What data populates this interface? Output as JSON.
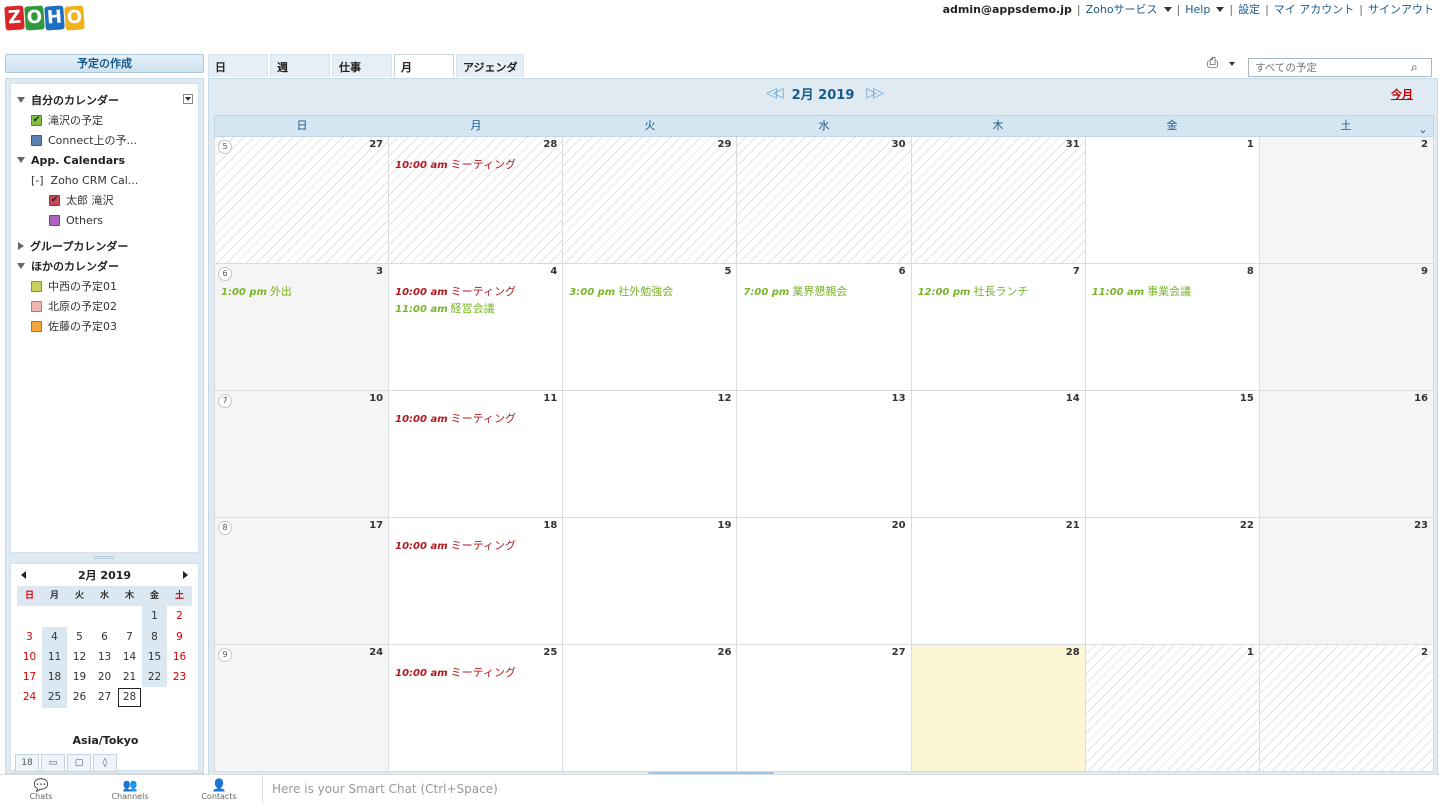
{
  "header": {
    "logo_letters": [
      "Z",
      "O",
      "H",
      "O"
    ],
    "logo_colors": [
      "#d8262a",
      "#2f9b3c",
      "#1d6fbf",
      "#f2b21c"
    ],
    "email": "admin@appsdemo.jp",
    "links": [
      {
        "label": "Zohoサービス",
        "dropdown": true
      },
      {
        "label": "Help",
        "dropdown": true
      },
      {
        "label": "設定",
        "dropdown": false
      },
      {
        "label": "マイ アカウント",
        "dropdown": false
      },
      {
        "label": "サインアウト",
        "dropdown": false
      }
    ]
  },
  "sidebar": {
    "create_label": "予定の作成",
    "my_calendars": {
      "label": "自分のカレンダー",
      "items": [
        {
          "label": "滝沢の予定",
          "color": "#7cc142",
          "checked": true
        },
        {
          "label": "Connect上の予...",
          "color": "#5b7fb0",
          "checked": false
        }
      ]
    },
    "app_calendars": {
      "label": "App. Calendars",
      "sub_label": "[-]  Zoho CRM Cal...",
      "items": [
        {
          "label": "太郎 滝沢",
          "color": "#c94a55",
          "checked": true
        },
        {
          "label": "Others",
          "color": "#b060c0",
          "checked": false
        }
      ]
    },
    "group_calendars": {
      "label": "グループカレンダー"
    },
    "other_calendars": {
      "label": "ほかのカレンダー",
      "items": [
        {
          "label": "中西の予定01",
          "color": "#c8cf5a",
          "checked": false
        },
        {
          "label": "北原の予定02",
          "color": "#f0b5b0",
          "checked": false
        },
        {
          "label": "佐藤の予定03",
          "color": "#f5a63a",
          "checked": false
        }
      ]
    },
    "mini_calendar": {
      "title": "2月 2019",
      "weekdays": [
        "日",
        "月",
        "火",
        "水",
        "木",
        "金",
        "土"
      ],
      "weeks": [
        [
          "",
          "",
          "",
          "",
          "",
          "1",
          "2"
        ],
        [
          "3",
          "4",
          "5",
          "6",
          "7",
          "8",
          "9"
        ],
        [
          "10",
          "11",
          "12",
          "13",
          "14",
          "15",
          "16"
        ],
        [
          "17",
          "18",
          "19",
          "20",
          "21",
          "22",
          "23"
        ],
        [
          "24",
          "25",
          "26",
          "27",
          "28",
          "",
          ""
        ]
      ],
      "today": "28",
      "timezone": "Asia/Tokyo"
    }
  },
  "tabs": [
    "日",
    "週",
    "仕事",
    "月",
    "アジェンダ"
  ],
  "active_tab": "月",
  "search": {
    "placeholder": "すべての予定"
  },
  "month_view": {
    "title": "2月 2019",
    "this_month": "今月",
    "weekdays": [
      "日",
      "月",
      "火",
      "水",
      "木",
      "金",
      "土"
    ],
    "weeks": [
      {
        "week_no": "5",
        "days": [
          "27",
          "28",
          "29",
          "30",
          "31",
          "1",
          "2"
        ]
      },
      {
        "week_no": "6",
        "days": [
          "3",
          "4",
          "5",
          "6",
          "7",
          "8",
          "9"
        ]
      },
      {
        "week_no": "7",
        "days": [
          "10",
          "11",
          "12",
          "13",
          "14",
          "15",
          "16"
        ]
      },
      {
        "week_no": "8",
        "days": [
          "17",
          "18",
          "19",
          "20",
          "21",
          "22",
          "23"
        ]
      },
      {
        "week_no": "9",
        "days": [
          "24",
          "25",
          "26",
          "27",
          "28",
          "1",
          "2"
        ]
      }
    ],
    "events": [
      {
        "week": 0,
        "day": 1,
        "slot": 0,
        "time": "10:00 am",
        "title": "ミーティング",
        "color": "red"
      },
      {
        "week": 1,
        "day": 0,
        "slot": 0,
        "time": "1:00 pm",
        "title": "外出",
        "color": "grn"
      },
      {
        "week": 1,
        "day": 1,
        "slot": 0,
        "time": "10:00 am",
        "title": "ミーティング",
        "color": "red"
      },
      {
        "week": 1,
        "day": 1,
        "slot": 1,
        "time": "11:00 am",
        "title": "経営会議",
        "color": "grn"
      },
      {
        "week": 1,
        "day": 2,
        "slot": 0,
        "time": "3:00 pm",
        "title": "社外勉強会",
        "color": "grn"
      },
      {
        "week": 1,
        "day": 3,
        "slot": 0,
        "time": "7:00 pm",
        "title": "業界懇親会",
        "color": "grn"
      },
      {
        "week": 1,
        "day": 4,
        "slot": 0,
        "time": "12:00 pm",
        "title": "社長ランチ",
        "color": "grn"
      },
      {
        "week": 1,
        "day": 5,
        "slot": 0,
        "time": "11:00 am",
        "title": "事業会議",
        "color": "grn"
      },
      {
        "week": 2,
        "day": 1,
        "slot": 0,
        "time": "10:00 am",
        "title": "ミーティング",
        "color": "red"
      },
      {
        "week": 3,
        "day": 1,
        "slot": 0,
        "time": "10:00 am",
        "title": "ミーティング",
        "color": "red"
      },
      {
        "week": 4,
        "day": 1,
        "slot": 0,
        "time": "10:00 am",
        "title": "ミーティング",
        "color": "red"
      }
    ]
  },
  "bottom_bar": {
    "items": [
      {
        "label": "Chats",
        "icon": "chat-icon"
      },
      {
        "label": "Channels",
        "icon": "channels-icon"
      },
      {
        "label": "Contacts",
        "icon": "contacts-icon"
      }
    ],
    "smart_chat_placeholder": "Here is your Smart Chat (Ctrl+Space)"
  }
}
